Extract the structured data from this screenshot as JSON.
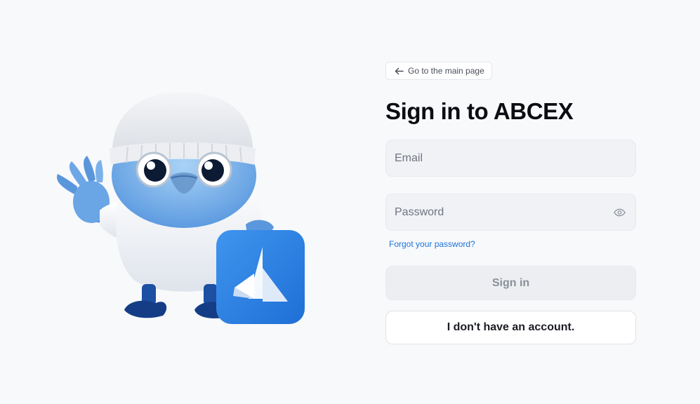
{
  "page": {
    "back_link": "Go to the main page",
    "title": "Sign in to ABCEX"
  },
  "form": {
    "email_placeholder": "Email",
    "email_value": "",
    "password_placeholder": "Password",
    "password_value": "",
    "forgot_link": "Forgot your password?",
    "sign_in_button": "Sign in",
    "no_account_button": "I don't have an account."
  },
  "icons": {
    "back": "arrow-left-icon",
    "password_toggle": "eye-icon",
    "mascot": "bird-mascot-illustration",
    "brand": "abcex-logo-icon"
  },
  "colors": {
    "background": "#f8f9fb",
    "accent_link": "#1a73d9",
    "brand_blue": "#2a7fe0",
    "disabled_button": "#eceef1"
  }
}
